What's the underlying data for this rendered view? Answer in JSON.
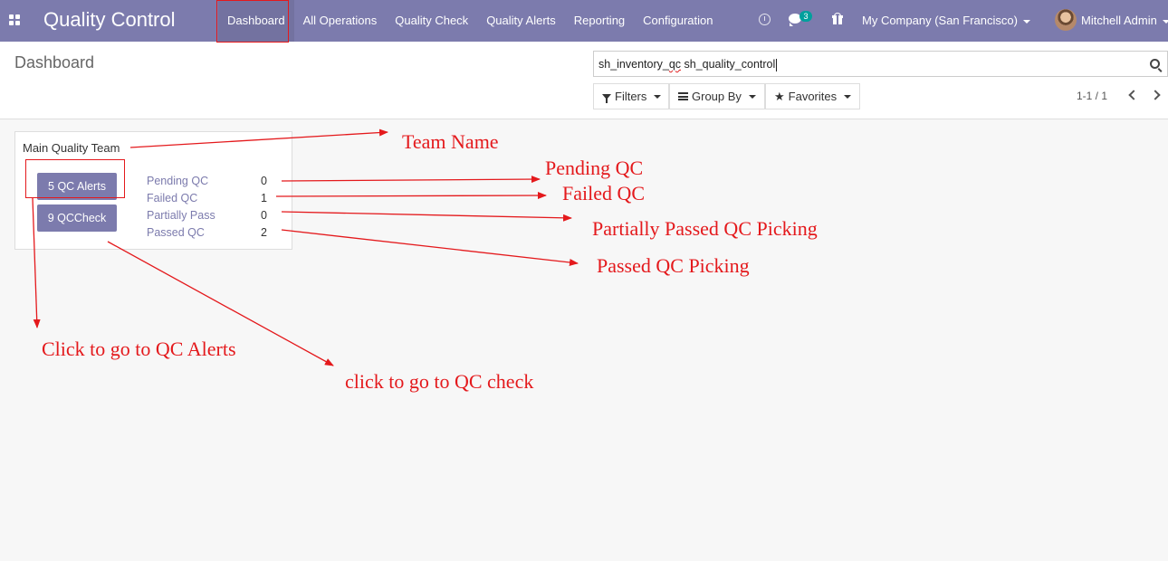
{
  "navbar": {
    "app_title": "Quality Control",
    "menu": [
      {
        "label": "Dashboard",
        "active": true
      },
      {
        "label": "All Operations"
      },
      {
        "label": "Quality Check"
      },
      {
        "label": "Quality Alerts"
      },
      {
        "label": "Reporting"
      },
      {
        "label": "Configuration"
      }
    ],
    "messages_count": "3",
    "company": "My Company (San Francisco)",
    "user": "Mitchell Admin",
    "icons": [
      "apps-icon",
      "clock-icon",
      "chat-icon",
      "gift-icon",
      "avatar"
    ]
  },
  "control_panel": {
    "title": "Dashboard",
    "search_value_parts": [
      "sh_inventory_",
      "qc",
      " sh_quality_control"
    ],
    "filters_label": "Filters",
    "group_by_label": "Group By",
    "favorites_label": "Favorites",
    "pager": "1-1 / 1"
  },
  "team_card": {
    "team_name": "Main Quality Team",
    "alerts_button": "5 QC Alerts",
    "check_button": "9 QCCheck",
    "stats": [
      {
        "label": "Pending QC",
        "value": "0"
      },
      {
        "label": "Failed QC",
        "value": "1"
      },
      {
        "label": "Partially Pass",
        "value": "0"
      },
      {
        "label": "Passed QC",
        "value": "2"
      }
    ]
  },
  "annotations": {
    "team_name": "Team Name",
    "pending_qc": "Pending QC",
    "failed_qc": "Failed QC",
    "partially_passed": "Partially Passed QC Picking",
    "passed_qc": "Passed QC Picking",
    "click_alerts": "Click to go to QC Alerts",
    "click_check": "click to go to QC check"
  },
  "colors": {
    "brand": "#7c7bad",
    "annotation": "#e4191c",
    "badge": "#00a09d"
  }
}
